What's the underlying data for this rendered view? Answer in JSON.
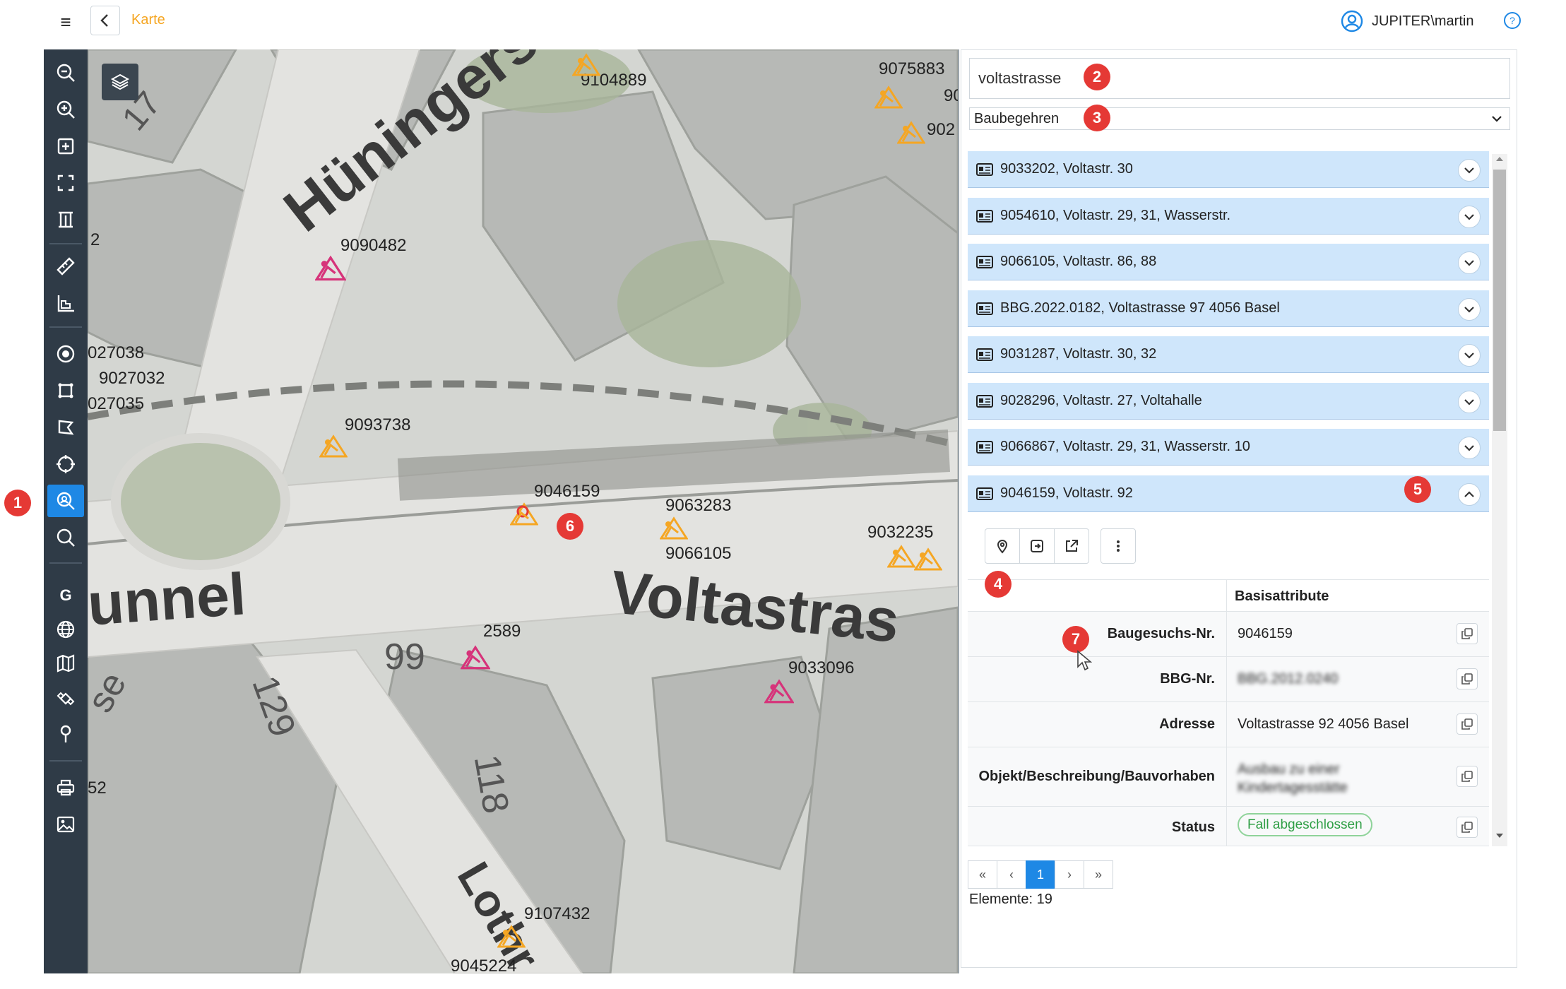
{
  "header": {
    "back_title": "Karte",
    "user_name": "JUPITER\\martin"
  },
  "toolbar": {
    "tools": [
      "zoom-out",
      "zoom-in",
      "zoom-box",
      "full-extent",
      "measure-height",
      "measure-distance",
      "measure-area",
      "point-select",
      "rect-select",
      "polygon-select",
      "circle-select",
      "search-identify",
      "search",
      "google",
      "globe",
      "map",
      "satellite",
      "pin",
      "print",
      "image-export"
    ],
    "active_tool": "search-identify"
  },
  "map": {
    "streets": [
      "Hüningerstr",
      "unnel",
      "Voltastras",
      "Lothr"
    ],
    "house_numbers": [
      "17",
      "99",
      "129",
      "118",
      "se"
    ],
    "markers": [
      "9104889",
      "9075883",
      "9090482",
      "9093738",
      "9046159",
      "9063283",
      "9066105",
      "9032235",
      "2589",
      "9033096",
      "9107432",
      "9045224",
      "027038",
      "9027032",
      "027035",
      "902",
      "90",
      "2",
      "52"
    ]
  },
  "search": {
    "query": "voltastrasse",
    "layer": "Baubegehren"
  },
  "results": [
    {
      "label": "9033202, Voltastr. 30"
    },
    {
      "label": "9054610, Voltastr. 29, 31, Wasserstr."
    },
    {
      "label": "9066105, Voltastr. 86, 88"
    },
    {
      "label": "BBG.2022.0182, Voltastrasse 97 4056 Basel"
    },
    {
      "label": "9031287, Voltastr. 30, 32"
    },
    {
      "label": "9028296, Voltastr. 27, Voltahalle"
    },
    {
      "label": "9066867, Voltastr. 29, 31, Wasserstr. 10"
    },
    {
      "label": "9046159, Voltastr. 92"
    }
  ],
  "detail": {
    "section_title": "Basisattribute",
    "attributes": [
      {
        "key": "Baugesuchs-Nr.",
        "value": "9046159"
      },
      {
        "key": "BBG-Nr.",
        "value": "BBG.2012.0240"
      },
      {
        "key": "Adresse",
        "value": "Voltastrasse 92 4056 Basel"
      },
      {
        "key": "Objekt/Beschreibung/Bauvorhaben",
        "value": "Ausbau zu einer Kindertagesstätte"
      },
      {
        "key": "Status",
        "value": "Fall abgeschlossen"
      }
    ]
  },
  "pager": {
    "first": "«",
    "prev": "‹",
    "current": "1",
    "next": "›",
    "last": "»",
    "count_text": "Elemente: 19"
  },
  "badges": [
    "1",
    "2",
    "3",
    "4",
    "5",
    "6",
    "7"
  ],
  "colors": {
    "accent": "#1e88e5",
    "toolbar_bg": "#2f3b47",
    "result_bg": "#cfe6fb",
    "badge": "#e53935",
    "orange_marker": "#f5a623",
    "pink_marker": "#d6337a",
    "status_green": "#2e9e44"
  }
}
